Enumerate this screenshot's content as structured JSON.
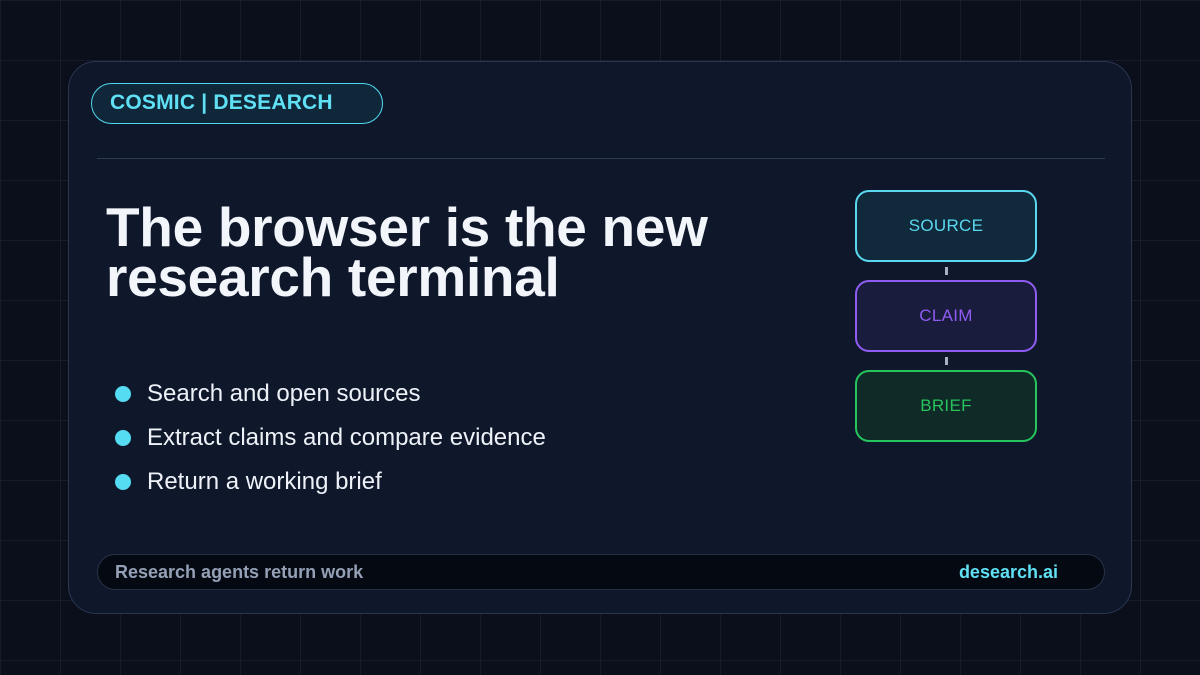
{
  "brand": {
    "label": "COSMIC | DESEARCH"
  },
  "headline": {
    "line1": "The browser is the new",
    "line2": "research terminal"
  },
  "bullets": [
    {
      "text": "Search and open sources"
    },
    {
      "text": "Extract claims and compare evidence"
    },
    {
      "text": "Return a working brief"
    }
  ],
  "flow": {
    "nodes": [
      {
        "label": "SOURCE",
        "color": "#5ad8f0"
      },
      {
        "label": "CLAIM",
        "color": "#8f5cf2"
      },
      {
        "label": "BRIEF",
        "color": "#26c45d"
      }
    ]
  },
  "footer": {
    "tagline": "Research agents return work",
    "url": "desearch.ai"
  },
  "colors": {
    "background": "#0a0f1b",
    "card": "#0f182b",
    "accent": "#5fe0f4",
    "text": "#f2f5fa"
  }
}
